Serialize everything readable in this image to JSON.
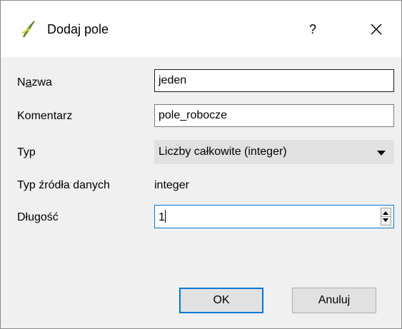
{
  "window": {
    "title": "Dodaj pole",
    "help": "?",
    "close": "✕"
  },
  "form": {
    "name": {
      "label_before": "N",
      "label_accel": "a",
      "label_after": "zwa",
      "value": "jeden"
    },
    "comment": {
      "label": "Komentarz",
      "value": "pole_robocze"
    },
    "type": {
      "label": "Typ",
      "selected": "Liczby całkowite (integer)"
    },
    "provider_type": {
      "label": "Typ źródła danych",
      "value": "integer"
    },
    "length": {
      "label": "Długość",
      "value": "1"
    }
  },
  "buttons": {
    "ok": "OK",
    "cancel": "Anuluj"
  },
  "colors": {
    "focus": "#0078d7",
    "button_face": "#e1e1e1",
    "dialog_bg": "#f0f0f0"
  },
  "icons": {
    "app": "qgis-leaf-icon",
    "help": "question-mark-icon",
    "close": "close-icon",
    "dropdown": "chevron-down-icon",
    "spin": "spin-buttons-icon"
  }
}
